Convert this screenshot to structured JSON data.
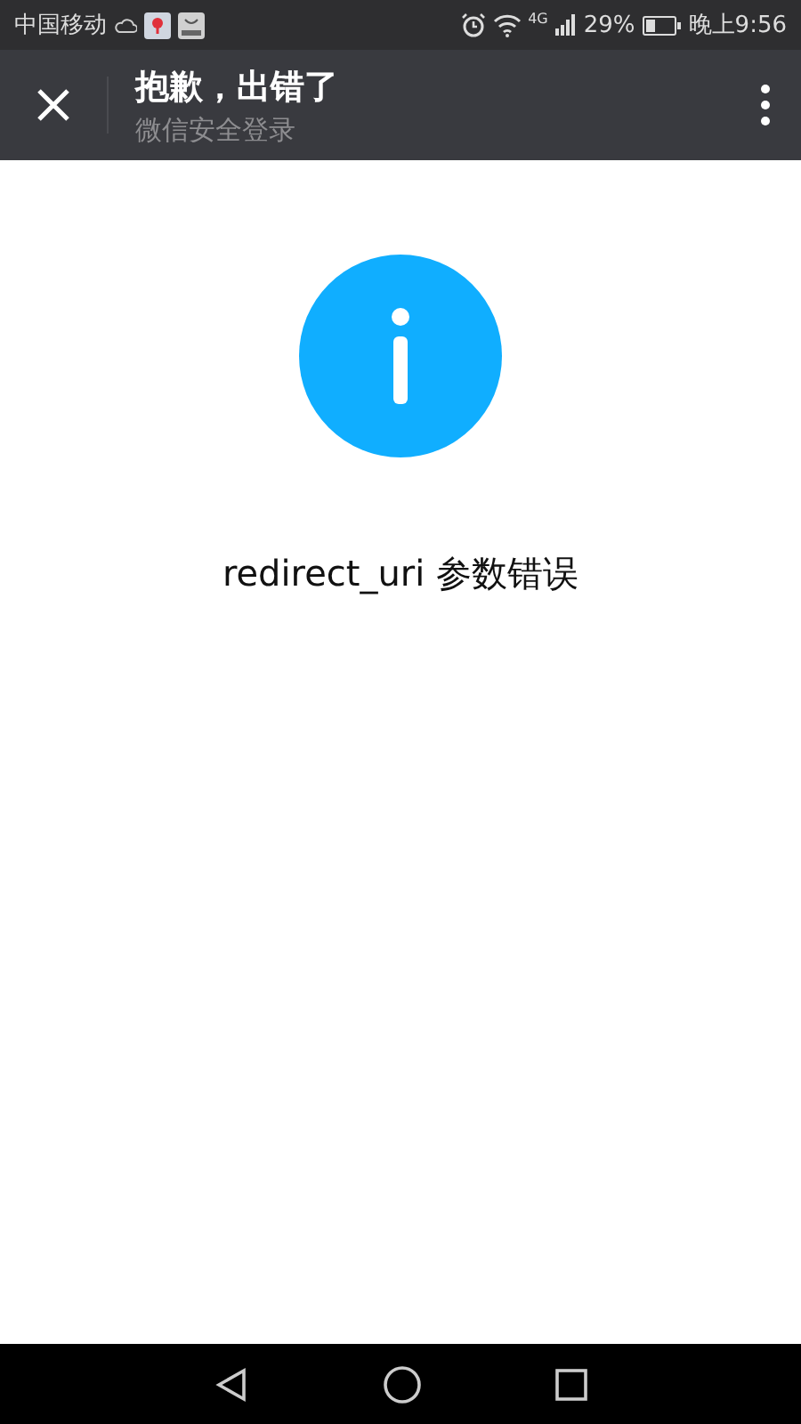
{
  "status_bar": {
    "carrier": "中国移动",
    "network": "4G",
    "battery": "29%",
    "time": "晚上9:56"
  },
  "header": {
    "title": "抱歉，出错了",
    "subtitle": "微信安全登录"
  },
  "message": "redirect_uri 参数错误"
}
